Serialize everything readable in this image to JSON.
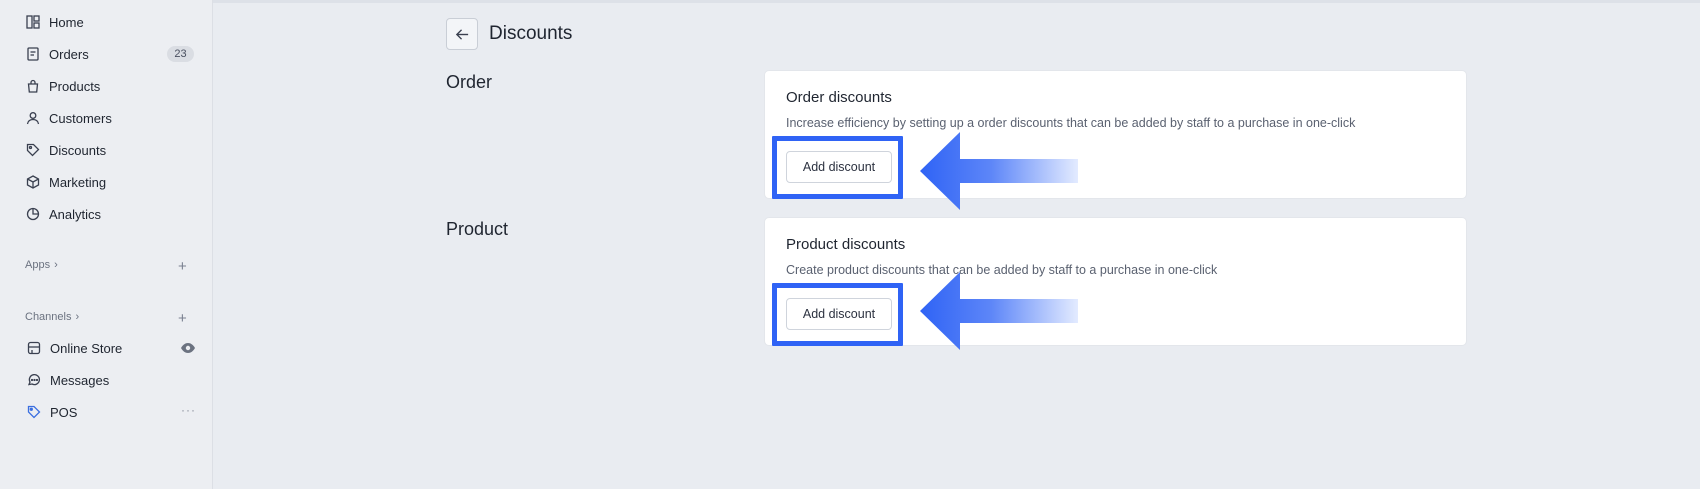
{
  "sidebar": {
    "items": [
      {
        "label": "Home",
        "icon": "dashboard-icon"
      },
      {
        "label": "Orders",
        "icon": "orders-icon",
        "badge": "23"
      },
      {
        "label": "Products",
        "icon": "bag-icon"
      },
      {
        "label": "Customers",
        "icon": "person-icon"
      },
      {
        "label": "Discounts",
        "icon": "tag-icon"
      },
      {
        "label": "Marketing",
        "icon": "cube-icon"
      },
      {
        "label": "Analytics",
        "icon": "pie-chart-icon"
      }
    ],
    "apps_label": "Apps",
    "channels_label": "Channels",
    "channels": [
      {
        "label": "Online Store",
        "icon": "store-icon"
      },
      {
        "label": "Messages",
        "icon": "chat-icon"
      },
      {
        "label": "POS",
        "icon": "pos-tag-icon"
      }
    ]
  },
  "header": {
    "title": "Discounts"
  },
  "sections": [
    {
      "heading": "Order",
      "card_title": "Order discounts",
      "card_description": "Increase efficiency by setting up a order discounts that can be added by staff to a purchase in one-click",
      "button_label": "Add discount"
    },
    {
      "heading": "Product",
      "card_title": "Product discounts",
      "card_description": "Create product discounts that can be added by staff to a purchase in one-click",
      "button_label": "Add discount"
    }
  ],
  "colors": {
    "highlight": "#2f63f5",
    "background": "#e9ecf1",
    "card": "#ffffff"
  }
}
